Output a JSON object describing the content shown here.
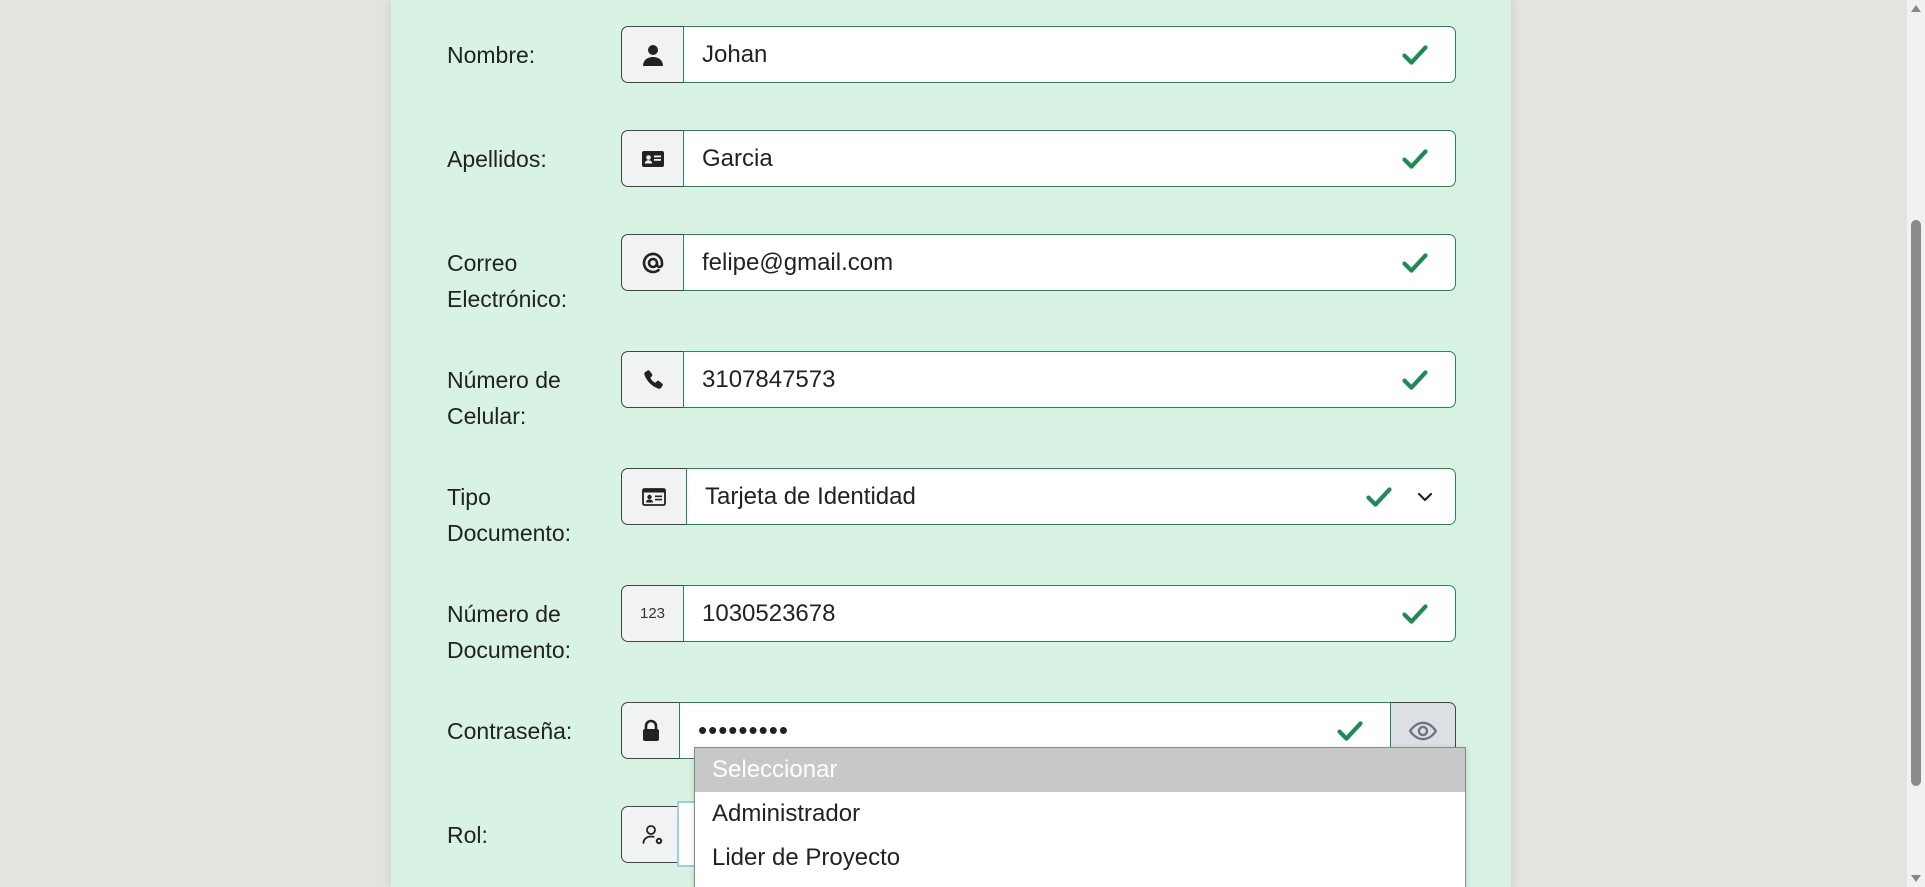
{
  "form": {
    "fields": [
      {
        "label": "Nombre:",
        "value": "Johan",
        "icon": "user-icon"
      },
      {
        "label": "Apellidos:",
        "value": "Garcia",
        "icon": "id-card-icon"
      },
      {
        "label": "Correo Electrónico:",
        "value": "felipe@gmail.com",
        "icon": "at-icon"
      },
      {
        "label": "Número de Celular:",
        "value": "3107847573",
        "icon": "phone-icon"
      },
      {
        "label": "Tipo Documento:",
        "value": "Tarjeta de Identidad",
        "icon": "id-card-icon"
      },
      {
        "label": "Número de Documento:",
        "value": "1030523678",
        "icon": "123-icon",
        "icon_text": "123"
      },
      {
        "label": "Contraseña:",
        "value": "•••••••••",
        "icon": "lock-icon"
      },
      {
        "label": "Rol:",
        "value": "",
        "icon": "user-gear-icon"
      }
    ],
    "rol_dropdown": {
      "options": [
        "Seleccionar",
        "Administrador",
        "Lider de Proyecto"
      ],
      "highlighted": "Seleccionar"
    }
  },
  "colors": {
    "card_bg": "#d8f3e3",
    "page_bg": "#e4e3df",
    "valid_green": "#1e8a56"
  }
}
